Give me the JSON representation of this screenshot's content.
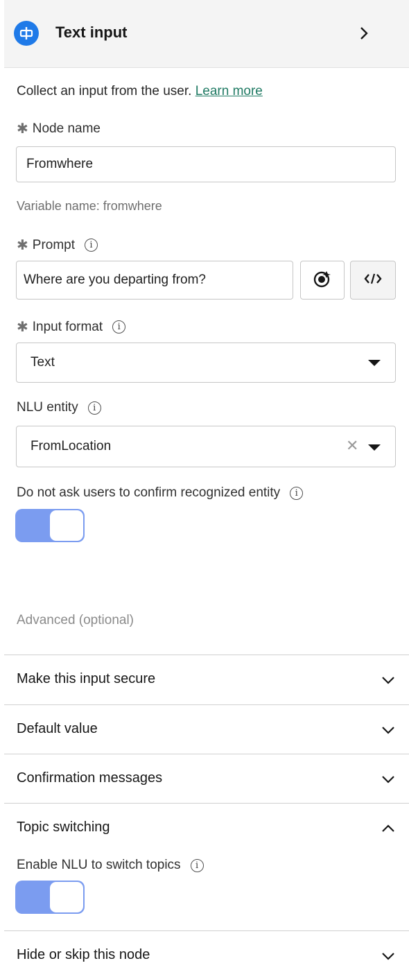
{
  "header": {
    "title": "Text input",
    "icon": "text-input-icon",
    "chevron": "chevron-right-icon"
  },
  "description": {
    "text": "Collect an input from the user.",
    "link": "Learn more"
  },
  "node_name": {
    "label": "Node name",
    "value": "Fromwhere",
    "variable_caption": "Variable name: fromwhere"
  },
  "prompt": {
    "label": "Prompt",
    "value": "Where are you departing from?",
    "ai_icon": "ai-assist-icon",
    "code_icon": "code-icon"
  },
  "input_format": {
    "label": "Input format",
    "value": "Text"
  },
  "nlu_entity": {
    "label": "NLU entity",
    "value": "FromLocation",
    "clear": "✕"
  },
  "confirm_entity": {
    "label": "Do not ask users to confirm recognized entity",
    "enabled": true
  },
  "advanced": {
    "label": "Advanced (optional)"
  },
  "sections": {
    "secure": "Make this input secure",
    "default_value": "Default value",
    "confirmation": "Confirmation messages",
    "topic_switching": "Topic switching",
    "topic_switch_toggle_label": "Enable NLU to switch topics",
    "topic_switch_enabled": true,
    "hide_skip": "Hide or skip this node"
  },
  "colors": {
    "accent": "#1f7ae8",
    "toggle_on": "#7b9cf0",
    "link": "#1f7a63"
  }
}
